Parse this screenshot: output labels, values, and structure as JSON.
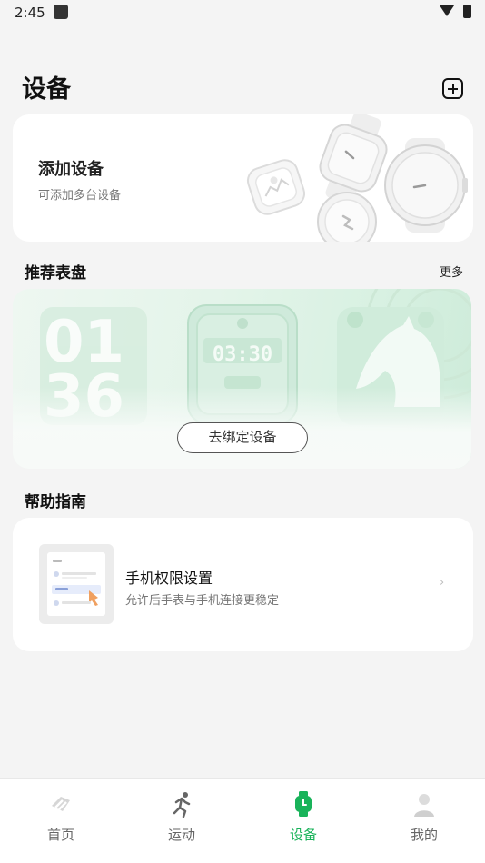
{
  "status_bar": {
    "time": "2:45"
  },
  "header": {
    "title": "设备"
  },
  "add_device": {
    "title": "添加设备",
    "subtitle": "可添加多台设备"
  },
  "faces": {
    "heading": "推荐表盘",
    "more": "更多",
    "face_time": "03:30",
    "bind_button": "去绑定设备"
  },
  "help": {
    "heading": "帮助指南",
    "item_title": "手机权限设置",
    "item_subtitle": "允许后手表与手机连接更稳定",
    "chevron": "›"
  },
  "bottom_nav": {
    "items": [
      {
        "label": "首页",
        "icon": "home-icon"
      },
      {
        "label": "运动",
        "icon": "running-icon"
      },
      {
        "label": "设备",
        "icon": "watch-icon",
        "active": true
      },
      {
        "label": "我的",
        "icon": "profile-icon"
      }
    ]
  },
  "colors": {
    "accent": "#19b35a",
    "background": "#f4f4f4",
    "card": "#ffffff"
  }
}
